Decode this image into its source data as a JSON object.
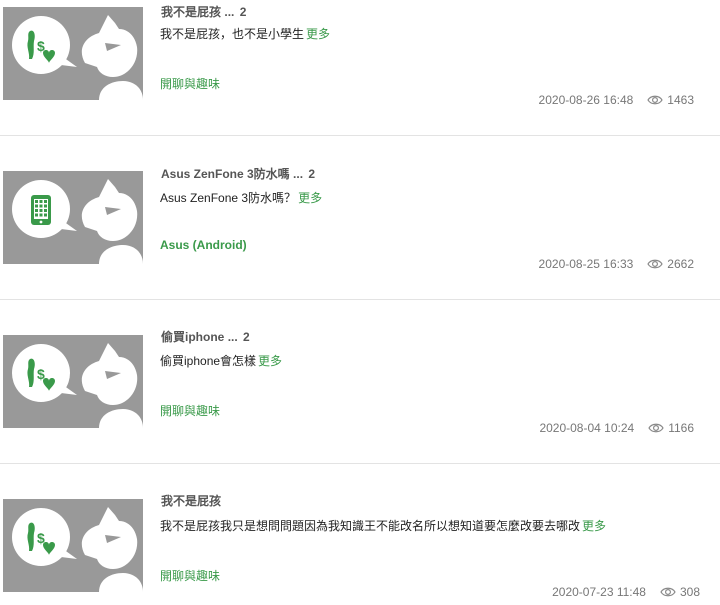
{
  "posts": [
    {
      "title": "我不是屁孩",
      "ellipsis": "...",
      "count": "2",
      "excerpt": "我不是屁孩，也不是小學生",
      "more": "更多",
      "board": "開聊與趣味",
      "board_bold": false,
      "icon": "taiwan-money-heart-icon",
      "date": "2020-08-26 16:48",
      "views": "1463"
    },
    {
      "title": "Asus ZenFone 3防水嗎",
      "ellipsis": "...",
      "count": "2",
      "excerpt": "Asus ZenFone 3防水嗎？",
      "more": "更多",
      "board": "Asus (Android)",
      "board_bold": true,
      "icon": "phone-icon",
      "date": "2020-08-25 16:33",
      "views": "2662"
    },
    {
      "title": "偷買iphone",
      "ellipsis": "...",
      "count": "2",
      "excerpt": "偷買iphone會怎樣",
      "more": "更多",
      "board": "開聊與趣味",
      "board_bold": false,
      "icon": "taiwan-money-heart-icon",
      "date": "2020-08-04 10:24",
      "views": "1166"
    },
    {
      "title": "我不是屁孩",
      "ellipsis": "",
      "count": "",
      "excerpt": "我不是屁孩我只是想問問題因為我知識王不能改名所以想知道要怎麼改要去哪改",
      "more": "更多",
      "board": "開聊與趣味",
      "board_bold": false,
      "icon": "taiwan-money-heart-icon",
      "date": "2020-07-23 11:48",
      "views": "308"
    }
  ],
  "colors": {
    "thumb_bg": "#999999",
    "accent_green": "#3a9a4a",
    "meta_text": "#777777"
  }
}
